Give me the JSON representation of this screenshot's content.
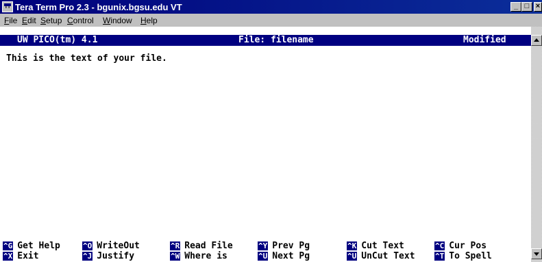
{
  "window": {
    "title": "Tera Term Pro 2.3 - bgunix.bgsu.edu VT",
    "icon_label": "TT"
  },
  "menu": [
    {
      "pre": "",
      "key": "F",
      "post": "ile"
    },
    {
      "pre": "",
      "key": "E",
      "post": "dit"
    },
    {
      "pre": "",
      "key": "S",
      "post": "etup"
    },
    {
      "pre": "",
      "key": "C",
      "post": "ontrol"
    },
    {
      "pre": "",
      "key": "W",
      "post": "indow"
    },
    {
      "pre": "",
      "key": "H",
      "post": "elp"
    }
  ],
  "pico": {
    "version": "UW PICO(tm) 4.1",
    "file": "File: filename",
    "status": "Modified",
    "content": "This is the text of your file."
  },
  "shortcuts": [
    {
      "key": "^G",
      "label": "Get Help"
    },
    {
      "key": "^O",
      "label": "WriteOut"
    },
    {
      "key": "^R",
      "label": "Read File"
    },
    {
      "key": "^Y",
      "label": "Prev Pg"
    },
    {
      "key": "^K",
      "label": "Cut Text"
    },
    {
      "key": "^C",
      "label": "Cur Pos"
    },
    {
      "key": "^X",
      "label": "Exit"
    },
    {
      "key": "^J",
      "label": "Justify"
    },
    {
      "key": "^W",
      "label": "Where is"
    },
    {
      "key": "^U",
      "label": "Next Pg"
    },
    {
      "key": "^U",
      "label": "UnCut Text"
    },
    {
      "key": "^T",
      "label": "To Spell"
    }
  ],
  "colors": {
    "title_bar": "#00007b",
    "header_bar": "#000080",
    "key_highlight": "#000080"
  },
  "icons": [
    "minimize-icon",
    "maximize-icon",
    "close-icon",
    "scroll-up-arrow-icon",
    "scroll-down-arrow-icon"
  ]
}
